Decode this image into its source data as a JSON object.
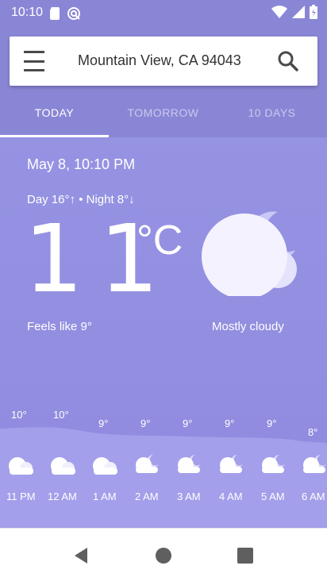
{
  "status": {
    "time": "10:10",
    "icons": [
      "sd-card-icon",
      "sync-icon",
      "wifi-icon",
      "signal-icon",
      "battery-icon"
    ]
  },
  "search": {
    "location": "Mountain View, CA 94043"
  },
  "tabs": [
    {
      "label": "TODAY",
      "active": true
    },
    {
      "label": "TOMORROW",
      "active": false
    },
    {
      "label": "10 DAYS",
      "active": false
    }
  ],
  "current": {
    "datetime": "May 8, 10:10 PM",
    "day_night": "Day 16°↑ • Night 8°↓",
    "temperature": "11",
    "unit": "°C",
    "feels_like": "Feels like 9°",
    "condition": "Mostly cloudy",
    "icon": "cloud-moon-icon"
  },
  "hourly": [
    {
      "time": "11 PM",
      "temp": "10°",
      "icon": "cloud-icon"
    },
    {
      "time": "12 AM",
      "temp": "10°",
      "icon": "cloud-icon"
    },
    {
      "time": "1 AM",
      "temp": "9°",
      "icon": "cloud-icon"
    },
    {
      "time": "2 AM",
      "temp": "9°",
      "icon": "cloud-moon-icon"
    },
    {
      "time": "3 AM",
      "temp": "9°",
      "icon": "cloud-moon-icon"
    },
    {
      "time": "4 AM",
      "temp": "9°",
      "icon": "cloud-moon-icon"
    },
    {
      "time": "5 AM",
      "temp": "9°",
      "icon": "cloud-moon-icon"
    },
    {
      "time": "6 AM",
      "temp": "8°",
      "icon": "cloud-moon-icon"
    }
  ],
  "colors": {
    "header_bg": "#8a86d6",
    "main_bg": "#9693e3",
    "wave": "#a9a6ee"
  }
}
